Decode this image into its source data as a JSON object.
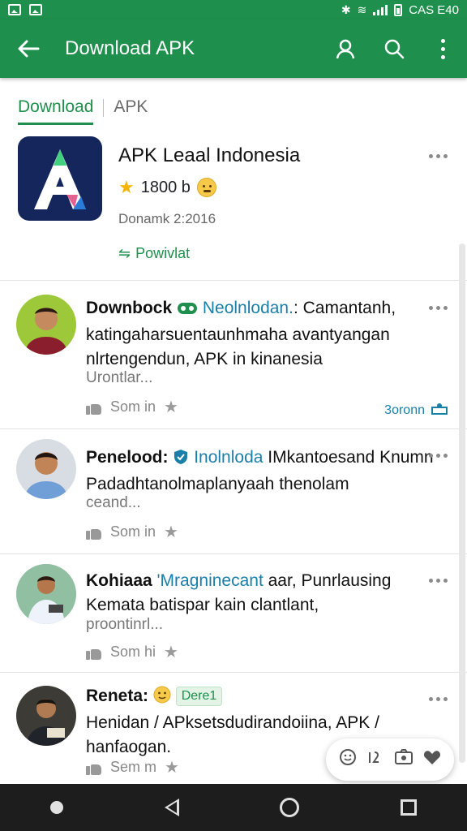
{
  "status_bar": {
    "time": "CAS E40"
  },
  "app_bar": {
    "title": "Download APK"
  },
  "tabs": [
    {
      "label": "Download"
    },
    {
      "label": "APK"
    }
  ],
  "app": {
    "name": "APK Leaal Indonesia",
    "rating": "1800 b",
    "date": "Donamk 2:2016",
    "provider": "Powivlat"
  },
  "reviews": [
    {
      "author": "Downbock",
      "badge": "Neolnlodan.",
      "text_lead": ": Camantanh,",
      "text": "katingaharsuentaunhmaha avantyangan nlrtengendun, APK in kinanesia",
      "snippet": "Urontlar...",
      "like_label": "Som in",
      "right_note": "3oronn"
    },
    {
      "author": "Penelood:",
      "badge": "Inolnloda",
      "text_lead": " IMkantoesand",
      "text": "Knumn Padadhtanolmaplanyaah thenolam",
      "snippet": "ceand...",
      "like_label": "Som in"
    },
    {
      "author": "Kohiaaa",
      "badge": "'Mragninecant",
      "text_lead": " aar, Punrlausing",
      "text": "Kemata batispar kain clantlant,",
      "snippet": "proontinrl...",
      "like_label": "Som hi"
    },
    {
      "author": "Reneta:",
      "badge": "Dere1",
      "text": "Henidan / APksetsdudirandoiina, APK / hanfaogan.",
      "like_label": "Sem m"
    }
  ],
  "colors": {
    "primary": "#1e8f4d",
    "link": "#1a7fa8",
    "star": "#f4b400"
  },
  "icons": [
    "back-arrow-icon",
    "account-icon",
    "search-icon",
    "more-vert-icon",
    "star-icon",
    "thumb-up-icon",
    "emoji-icon"
  ]
}
